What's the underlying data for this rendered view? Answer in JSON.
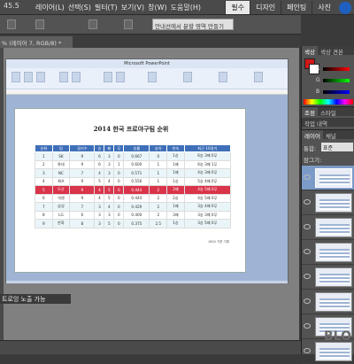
{
  "menubar": {
    "zoom": "45.5",
    "menus": [
      "레이어(L)",
      "선택(S)",
      "필터(T)",
      "보기(V)",
      "창(W)",
      "도움말(H)"
    ],
    "workspaces": [
      "필수",
      "디자인",
      "페인팅",
      "사진"
    ]
  },
  "options": {
    "refine_placeholder": "안내선에서 분할 영역 만들기"
  },
  "document": {
    "tab_label": "% (레이어 7, RGB/8) *",
    "ppt_title": "Microsoft PowerPoint"
  },
  "slide": {
    "title": "2014 한국 프로야구팀 순위",
    "headers": [
      "순위",
      "팀",
      "경기수",
      "승",
      "패",
      "무",
      "승률",
      "승차",
      "연속",
      "최근 10경기"
    ],
    "rows": [
      [
        "1",
        "SK",
        "9",
        "6",
        "3",
        "0",
        "0.667",
        "0",
        "1승",
        "6승 3패 0무"
      ],
      [
        "2",
        "롯데",
        "9",
        "6",
        "3",
        "1",
        "0.600",
        "1",
        "1패",
        "6승 3패 1무"
      ],
      [
        "3",
        "NC",
        "7",
        "4",
        "3",
        "0",
        "0.571",
        "1",
        "1패",
        "4승 3패 0무"
      ],
      [
        "4",
        "KIA",
        "9",
        "5",
        "4",
        "0",
        "0.556",
        "1",
        "1승",
        "5승 4패 0무"
      ],
      [
        "5",
        "두산",
        "9",
        "4",
        "5",
        "0",
        "0.444",
        "2",
        "2패",
        "4승 5패 0무"
      ],
      [
        "6",
        "넥센",
        "9",
        "4",
        "5",
        "0",
        "0.444",
        "2",
        "2승",
        "4승 5패 0무"
      ],
      [
        "7",
        "삼성",
        "7",
        "3",
        "4",
        "0",
        "0.429",
        "2",
        "1패",
        "3승 4패 0무"
      ],
      [
        "8",
        "LG",
        "6",
        "3",
        "3",
        "0",
        "0.400",
        "2",
        "3패",
        "3승 3패 0무"
      ],
      [
        "9",
        "한화",
        "8",
        "3",
        "5",
        "0",
        "0.375",
        "2.5",
        "1승",
        "3승 5패 0무"
      ]
    ],
    "highlight_row": 4,
    "footnote": "1604 기준 기록"
  },
  "hint": "트로잉 노출 가능",
  "panels": {
    "color_tabs": [
      "색상",
      "색상 견본"
    ],
    "color_values": [
      "R",
      "G",
      "B"
    ],
    "style_tabs": [
      "조정",
      "스타일"
    ],
    "history_tabs": [
      "작업 내역"
    ],
    "layer_tabs": [
      "레이어",
      "채널"
    ],
    "blend_mode": "표준",
    "lock_label": "잠그기:",
    "filter_label": "통합:"
  },
  "watermark": "BLO"
}
